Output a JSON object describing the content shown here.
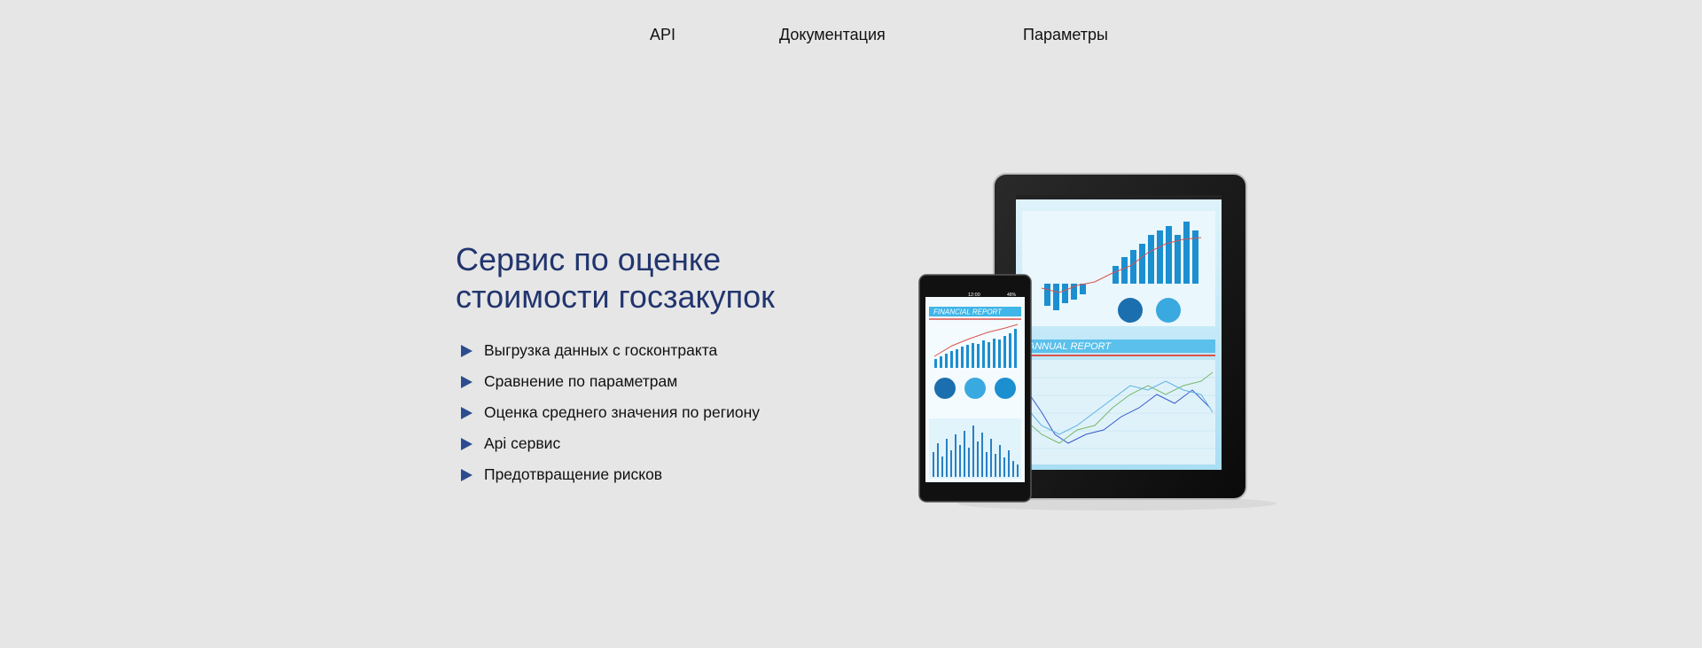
{
  "nav": {
    "items": [
      {
        "label": "API"
      },
      {
        "label": "Документация"
      },
      {
        "label": "Параметры"
      }
    ]
  },
  "hero": {
    "title_line1": "Сервис по оценке",
    "title_line2": "стоимости госзакупок",
    "features": [
      "Выгрузка данных с госконтракта",
      "Сравнение по параметрам",
      "Оценка среднего значения по региону",
      "Api сервис",
      "Предотвращение рисков"
    ]
  },
  "illustration": {
    "phone_time": "12:00",
    "phone_battery": "46%",
    "phone_report_title": "FINANCIAL REPORT",
    "tablet_report_title": "ANNUAL REPORT"
  },
  "colors": {
    "background": "#e6e6e6",
    "title": "#21356e",
    "bullet": "#2b4d8f",
    "chart_accent": "#1b8fd0"
  }
}
